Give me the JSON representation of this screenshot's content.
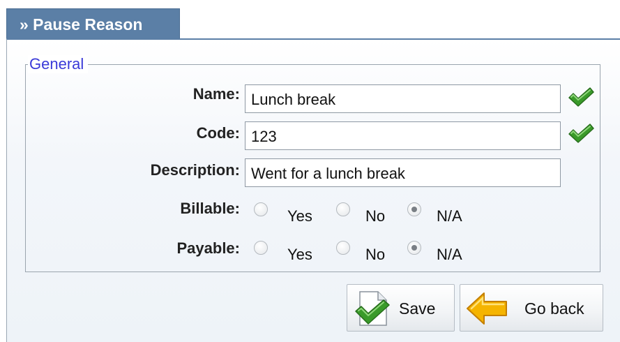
{
  "panel": {
    "title": "» Pause Reason"
  },
  "fieldset": {
    "legend": "General"
  },
  "form": {
    "name": {
      "label": "Name:",
      "value": "Lunch break",
      "status_icon": "green-check-icon"
    },
    "code": {
      "label": "Code:",
      "value": "123",
      "status_icon": "green-check-icon"
    },
    "description": {
      "label": "Description:",
      "value": "Went for a lunch break"
    },
    "billable": {
      "label": "Billable:",
      "options": [
        "Yes",
        "No",
        "N/A"
      ],
      "selected": "N/A"
    },
    "payable": {
      "label": "Payable:",
      "options": [
        "Yes",
        "No",
        "N/A"
      ],
      "selected": "N/A"
    }
  },
  "actions": {
    "save_label": "Save",
    "back_label": "Go back"
  },
  "colors": {
    "tab_background": "#5b7fa6",
    "legend_text": "#3a3ad8",
    "check_green": "#3a9a2a",
    "back_arrow": "#f5b400"
  }
}
